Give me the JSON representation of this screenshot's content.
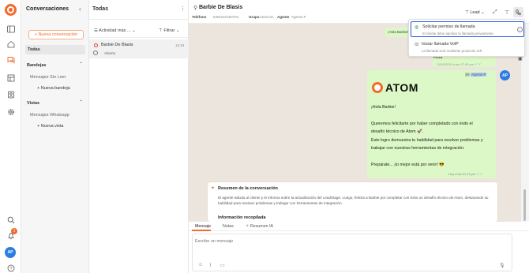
{
  "sidebar": {
    "title": "Conversaciones",
    "new_conversation": "+ Nueva conversación",
    "todas": "Todas",
    "bandejas": "Bandejas",
    "mensajes_sin_leer": "Mensajes Sin Leer",
    "nueva_bandeja": "+ Nueva bandeja",
    "vistas": "Vistas",
    "mensajes_whatsapp": "Mensajes Whatsapp",
    "nueva_vista": "+ Nueva vista"
  },
  "rail": {
    "notification_count": "1",
    "avatar": "AP"
  },
  "list": {
    "title": "Todas",
    "activity_filter": "Actividad más ...",
    "filter": "Filtrar",
    "conversation": {
      "name": "Barbie De Blasis",
      "time": "13:19",
      "status": "Abierto"
    }
  },
  "chat": {
    "contact_name": "Barbie De Blasis",
    "phone_label": "Teléfono",
    "phone_value": "5491161053764",
    "group_label": "Grupo",
    "group_value": "Atencion",
    "agent_label": "Agente",
    "agent_value": "Agente P",
    "lead_label": "Lead",
    "top_bubble": "¡Hola Barbie!",
    "hola_text": "Hola",
    "hola_time": "11/09/2025 a las 07:45 pm",
    "bubble_agent_label": "Agente P",
    "atom_word": "ATOM",
    "message_lines": [
      "¡Hola Barbie!",
      "Queremos felicitarte por haber completado con éxito el",
      "desafío técnico de Atom 🚀.",
      "Este logro demuestra tu habilidad para resolver problemas y",
      "trabajar con nuestras herramientas de integración.",
      "Prepárate... ¡lo mejor está por venir! 😎"
    ],
    "message_time": "Hoy a las 01:19 pm",
    "agent_avatar": "AP",
    "summary_title": "Resumen de la conversación",
    "summary_text": "El agente saluda al cliente y le informa sobre la actualización del LeadStage. Luego, felicita a Barbie por completar con éxito un desafío técnico de Atom, destacando su habilidad para resolver problemas y trabajar con herramientas de integración.",
    "info_title": "Información recopilada",
    "tabs": [
      "Mensaje",
      "Notas",
      "Resumen IA"
    ],
    "composer_placeholder": "Escribe un mensaje"
  },
  "call_menu": {
    "items": [
      {
        "title": "Solicitar permiso de llamada",
        "desc": "El cliente debe aprobar la llamada previamente."
      },
      {
        "title": "Iniciar llamada VoIP",
        "desc": "La llamada será mediante protocolo SIP."
      }
    ]
  },
  "colors": {
    "brand": "#f26b2a",
    "bubble": "#dcf8c6",
    "chat_bg": "#ece5dd",
    "selected_outline": "#2a5bd7"
  }
}
